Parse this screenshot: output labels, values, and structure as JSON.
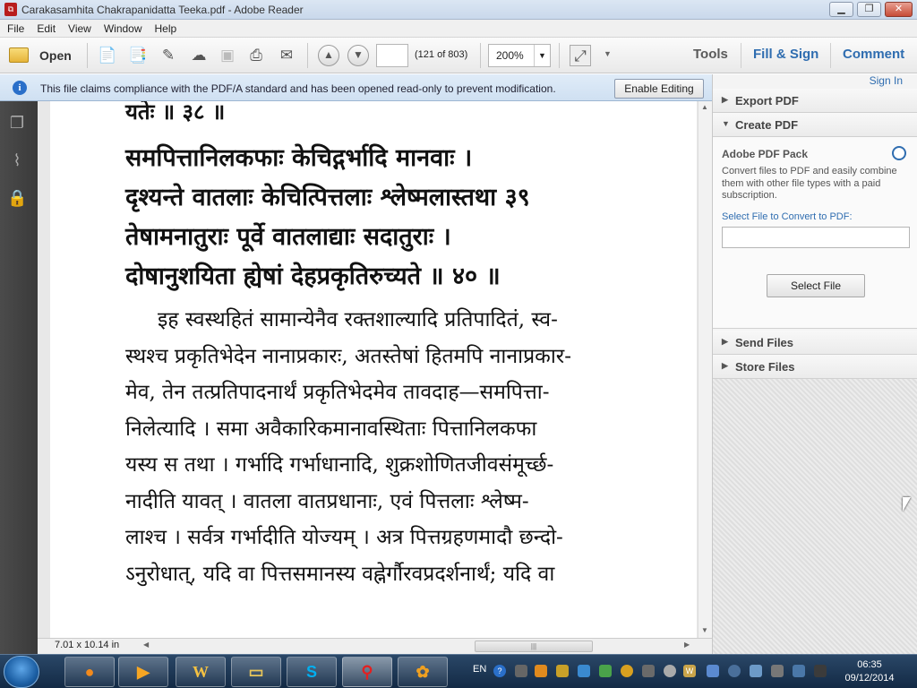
{
  "window": {
    "title": "Carakasamhita Chakrapanidatta Teeka.pdf - Adobe Reader"
  },
  "menu": [
    "File",
    "Edit",
    "View",
    "Window",
    "Help"
  ],
  "toolbar": {
    "open_label": "Open",
    "page_input": "",
    "page_status": "(121 of 803)",
    "zoom": "200%",
    "tabs": [
      "Tools",
      "Fill & Sign",
      "Comment"
    ]
  },
  "infobar": {
    "message": "This file claims compliance with the PDF/A standard and has been opened read-only to prevent modification.",
    "button": "Enable Editing"
  },
  "document": {
    "verse_lines": [
      "यतेः ॥ ३८ ॥",
      "समपित्तानिलकफाः केचिद्गर्भादि मानवाः ।",
      "दृश्यन्ते वातलाः केचित्पित्तलाः श्लेष्मलास्तथा ३९",
      "तेषामनातुराः पूर्वे वातलाद्याः सदातुराः ।",
      "दोषानुशयिता ह्येषां देहप्रकृतिरुच्यते ॥ ४० ॥"
    ],
    "commentary_lines": [
      "इह स्वस्थहितं सामान्येनैव रक्तशाल्यादि प्रतिपादितं, स्व-",
      "स्थश्च प्रकृतिभेदेन नानाप्रकारः, अतस्तेषां हितमपि नानाप्रकार-",
      "मेव, तेन तत्प्रतिपादनार्थं प्रकृतिभेदमेव तावदाह—समपित्ता-",
      "निलेत्यादि । समा अवैकारिकमानावस्थिताः पित्तानिलकफा",
      "यस्य स तथा । गर्भादि गर्भाधानादि, शुक्रशोणितजीवसंमूर्च्छ-",
      "नादीति यावत् । वातला वातप्रधानाः, एवं पित्तलाः श्लेष्म-",
      "लाश्च । सर्वत्र गर्भादीति योज्यम् । अत्र पित्तग्रहणमादौ छन्दो-",
      "ऽनुरोधात्, यदि वा पित्तसमानस्य वह्नेर्गौरवप्रदर्शनार्थं; यदि वा"
    ],
    "page_size": "7.01 x 10.14 in"
  },
  "rightpane": {
    "sign_in": "Sign In",
    "export_pdf": "Export PDF",
    "create_pdf": "Create PDF",
    "pack_title": "Adobe PDF Pack",
    "pack_desc": "Convert files to PDF and easily combine them with other file types with a paid subscription.",
    "select_label": "Select File to Convert to PDF:",
    "select_button": "Select File",
    "send_files": "Send Files",
    "store_files": "Store Files"
  },
  "taskbar": {
    "lang": "EN",
    "time": "06:35",
    "date": "09/12/2014"
  }
}
